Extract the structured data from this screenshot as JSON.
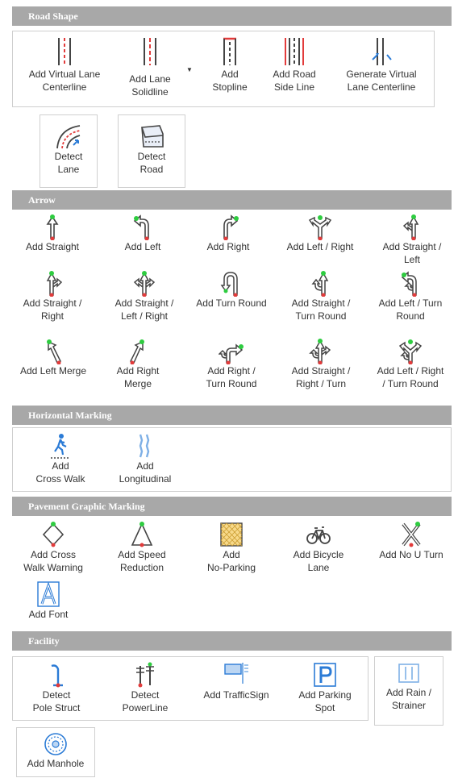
{
  "sections": {
    "road_shape": "Road Shape",
    "arrow": "Arrow",
    "horizontal": "Horizontal Marking",
    "pavement": "Pavement Graphic Marking",
    "facility": "Facility"
  },
  "road_shape": {
    "add_virtual": [
      "Add Virtual Lane",
      "Centerline"
    ],
    "add_lane_solid": [
      "Add Lane",
      "Solidline"
    ],
    "add_stopline": [
      "Add",
      "Stopline"
    ],
    "add_side": [
      "Add Road",
      "Side Line"
    ],
    "gen_virtual": [
      "Generate Virtual",
      "Lane Centerline"
    ],
    "detect_lane": [
      "Detect",
      "Lane"
    ],
    "detect_road": [
      "Detect",
      "Road"
    ]
  },
  "arrow": {
    "straight": [
      "Add Straight",
      ""
    ],
    "left": [
      "Add Left",
      ""
    ],
    "right": [
      "Add Right",
      ""
    ],
    "left_right": [
      "Add Left / Right",
      ""
    ],
    "straight_left": [
      "Add Straight /",
      "Left"
    ],
    "straight_right": [
      "Add Straight /",
      "Right"
    ],
    "straight_left_right": [
      "Add Straight /",
      "Left / Right"
    ],
    "turn_round": [
      "Add Turn Round",
      ""
    ],
    "straight_turn_round": [
      "Add Straight /",
      "Turn Round"
    ],
    "left_turn_round": [
      "Add Left / Turn",
      "Round"
    ],
    "left_merge": [
      "Add Left Merge",
      ""
    ],
    "right_merge": [
      "Add Right",
      "Merge"
    ],
    "right_turn_round": [
      "Add Right /",
      "Turn Round"
    ],
    "straight_right_turn": [
      "Add Straight /",
      "Right / Turn"
    ],
    "left_right_turn_round": [
      "Add Left / Right",
      "/ Turn Round"
    ]
  },
  "horizontal": {
    "cross_walk": [
      "Add",
      "Cross Walk"
    ],
    "longitudinal": [
      "Add",
      "Longitudinal"
    ]
  },
  "pavement": {
    "cross_walk_warning": [
      "Add Cross",
      "Walk Warning"
    ],
    "speed_reduction": [
      "Add Speed",
      "Reduction"
    ],
    "no_parking": [
      "Add",
      "No-Parking"
    ],
    "bicycle_lane": [
      "Add Bicycle",
      "Lane"
    ],
    "no_u_turn": [
      "Add No U Turn",
      ""
    ],
    "font": [
      "Add Font",
      ""
    ]
  },
  "facility": {
    "pole_struct": [
      "Detect",
      "Pole Struct"
    ],
    "power_line": [
      "Detect",
      "PowerLine"
    ],
    "traffic_sign": [
      "Add TrafficSign",
      ""
    ],
    "parking_spot": [
      "Add Parking",
      "Spot"
    ],
    "rain_strainer": [
      "Add Rain /",
      "Strainer"
    ],
    "manhole": [
      "Add Manhole",
      ""
    ]
  }
}
